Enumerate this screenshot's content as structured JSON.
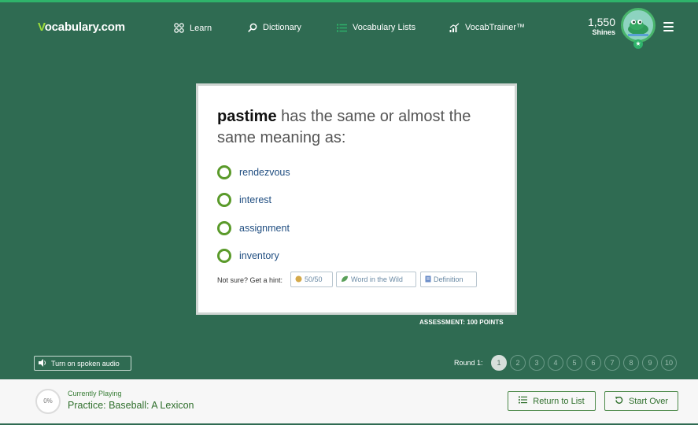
{
  "header": {
    "logo_prefix": "V",
    "logo_rest": "ocabulary.com",
    "nav": [
      {
        "label": "Learn",
        "icon": "learn-grid-icon"
      },
      {
        "label": "Dictionary",
        "icon": "search-icon"
      },
      {
        "label": "Vocabulary Lists",
        "icon": "list-icon"
      },
      {
        "label": "VocabTrainer™",
        "icon": "trending-icon"
      }
    ],
    "shines_count": "1,550",
    "shines_label": "Shines",
    "avatar_icon": "frog-avatar-icon",
    "menu_icon": "hamburger-menu-icon"
  },
  "question": {
    "word": "pastime",
    "prompt": " has the same or almost the same meaning as:",
    "choices": [
      "rendezvous",
      "interest",
      "assignment",
      "inventory"
    ],
    "hint_label": "Not sure? Get a hint:",
    "hints": [
      {
        "label": "50/50",
        "icon": "coin-icon"
      },
      {
        "label": "Word in the Wild",
        "icon": "leaf-icon"
      },
      {
        "label": "Definition",
        "icon": "note-icon"
      }
    ],
    "assessment": "ASSESSMENT: 100 POINTS"
  },
  "controls": {
    "audio_label": "Turn on spoken audio",
    "round_label": "Round 1:",
    "rounds": [
      "1",
      "2",
      "3",
      "4",
      "5",
      "6",
      "7",
      "8",
      "9",
      "10"
    ],
    "active_round": "1"
  },
  "footer": {
    "progress": "0%",
    "currently_playing_label": "Currently Playing",
    "title": "Practice: Baseball: A Lexicon",
    "return_label": "Return to List",
    "start_over_label": "Start Over"
  },
  "colors": {
    "background": "#2f6b52",
    "accent_green": "#2fb36b",
    "radio_green": "#5a9a2a",
    "choice_blue": "#1f4d80"
  }
}
